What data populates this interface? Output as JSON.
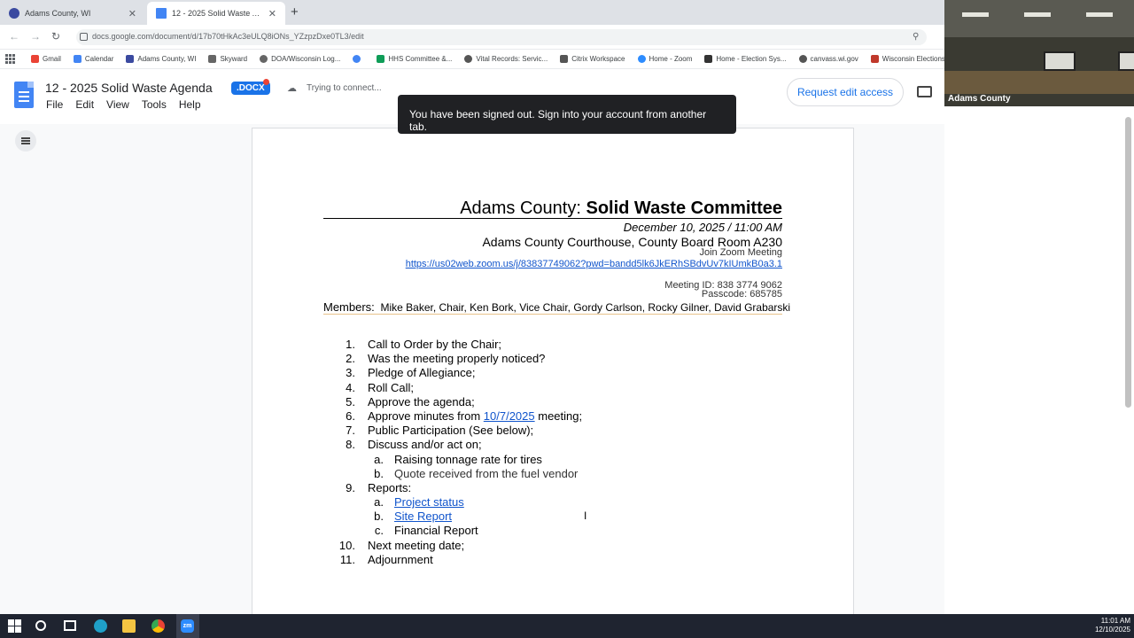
{
  "browser": {
    "tabs": [
      {
        "title": "Adams County, WI",
        "active": false
      },
      {
        "title": "12 - 2025 Solid Waste Agenda",
        "active": true
      }
    ],
    "new_tab_label": "+",
    "url": "docs.google.com/document/d/17b70tHkAc3eULQ8iONs_YZzpzDxe0TL3/edit",
    "bookmarks": [
      {
        "label": "Gmail",
        "color": "#ea4335"
      },
      {
        "label": "Calendar",
        "color": "#4285f4"
      },
      {
        "label": "Adams County, WI",
        "color": "#3b4aa0"
      },
      {
        "label": "Skyward",
        "color": "#666666"
      },
      {
        "label": "DOA/Wisconsin Log...",
        "color": "#666666"
      },
      {
        "label": "",
        "color": "#4285f4"
      },
      {
        "label": "HHS Committee &...",
        "color": "#0f9d58"
      },
      {
        "label": "Vital Records: Servic...",
        "color": "#555555"
      },
      {
        "label": "Citrix Workspace",
        "color": "#555555"
      },
      {
        "label": "Home - Zoom",
        "color": "#2d8cff"
      },
      {
        "label": "Home - Election Sys...",
        "color": "#333333"
      },
      {
        "label": "canvass.wi.gov",
        "color": "#555555"
      },
      {
        "label": "Wisconsin Elections...",
        "color": "#c0392b"
      }
    ]
  },
  "docs": {
    "title": "12 - 2025 Solid Waste Agenda",
    "badge": ".DOCX",
    "status": "Trying to connect...",
    "menus": [
      "File",
      "Edit",
      "View",
      "Tools",
      "Help"
    ],
    "toast": "You have been signed out. Sign into your account from another tab.",
    "request_button": "Request edit access"
  },
  "document": {
    "county": "Adams County: ",
    "committee": "Solid Waste Committee",
    "date": "December 10, 2025 / 11:00 AM",
    "location": "Adams County Courthouse, County Board Room A230",
    "zoom_label": "Join Zoom Meeting",
    "zoom_link": "https://us02web.zoom.us/j/83837749062?pwd=bandd5lk6JkERhSBdvUv7kIUmkB0a3.1",
    "meeting_id": "Meeting ID: 838 3774 9062",
    "passcode": "Passcode: 685785",
    "members_label": "Members:",
    "members": "Mike Baker, Chair, Ken Bork, Vice Chair, Gordy Carlson, Rocky Gilner, David Grabarski",
    "agenda": {
      "i1": {
        "num": "1.",
        "text": "Call to Order by the Chair;"
      },
      "i2": {
        "num": "2.",
        "text": "Was the meeting properly noticed?"
      },
      "i3": {
        "num": "3.",
        "text": "Pledge of Allegiance;"
      },
      "i4": {
        "num": "4.",
        "text": "Roll Call;"
      },
      "i5": {
        "num": "5.",
        "text": "Approve the agenda;"
      },
      "i6": {
        "num": "6.",
        "pre": "Approve minutes from ",
        "link": "10/7/2025",
        "post": " meeting;"
      },
      "i7": {
        "num": "7.",
        "text": "Public Participation (See below);"
      },
      "i8": {
        "num": "8.",
        "text": "Discuss and/or act on;"
      },
      "i8a": {
        "num": "a.",
        "text": "Raising tonnage rate for tires"
      },
      "i8b": {
        "num": "b.",
        "text": "Quote received from the fuel vendor"
      },
      "i9": {
        "num": "9.",
        "text": "Reports:"
      },
      "i9a": {
        "num": "a.",
        "text": "Project status"
      },
      "i9b": {
        "num": "b.",
        "text": "Site Report"
      },
      "i9c": {
        "num": "c.",
        "text": "Financial Report"
      },
      "i10": {
        "num": "10.",
        "text": "Next meeting date;"
      },
      "i11": {
        "num": "11.",
        "text": "Adjournment"
      }
    }
  },
  "video": {
    "name": "Adams County"
  },
  "taskbar": {
    "zoom_label": "zm",
    "time": "11:01 AM",
    "date": "12/10/2025"
  }
}
